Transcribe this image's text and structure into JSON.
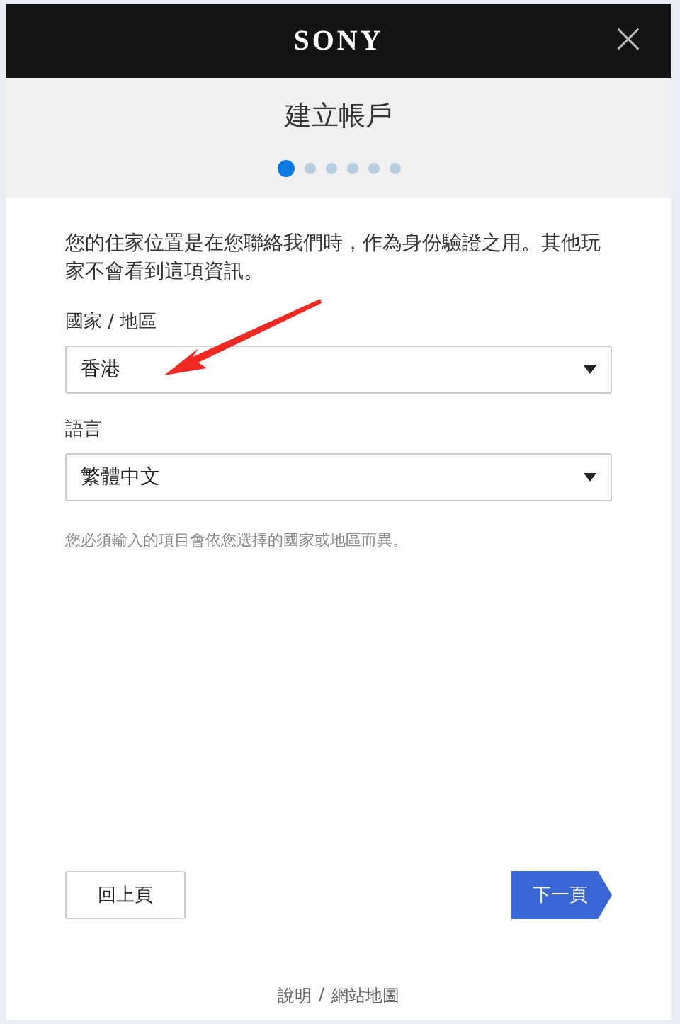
{
  "header": {
    "logo": "SONY",
    "close": "×"
  },
  "title": "建立帳戶",
  "steps": [
    {
      "selected": true
    },
    {
      "selected": false
    },
    {
      "selected": false
    },
    {
      "selected": false
    },
    {
      "selected": false
    },
    {
      "selected": false
    }
  ],
  "intro": "您的住家位置是在您聯絡我們時，作為身份驗證之用。其他玩家不會看到這項資訊。",
  "fields": [
    {
      "label": "國家 / 地區",
      "value": "香港"
    },
    {
      "label": "語言",
      "value": "繁體中文"
    }
  ],
  "note": "您必須輸入的項目會依您選擇的國家或地區而異。",
  "buttons": {
    "back": "回上頁",
    "next": "下一頁"
  },
  "footer": {
    "links": [
      "說明",
      "網站地圖"
    ],
    "separator": "/"
  }
}
